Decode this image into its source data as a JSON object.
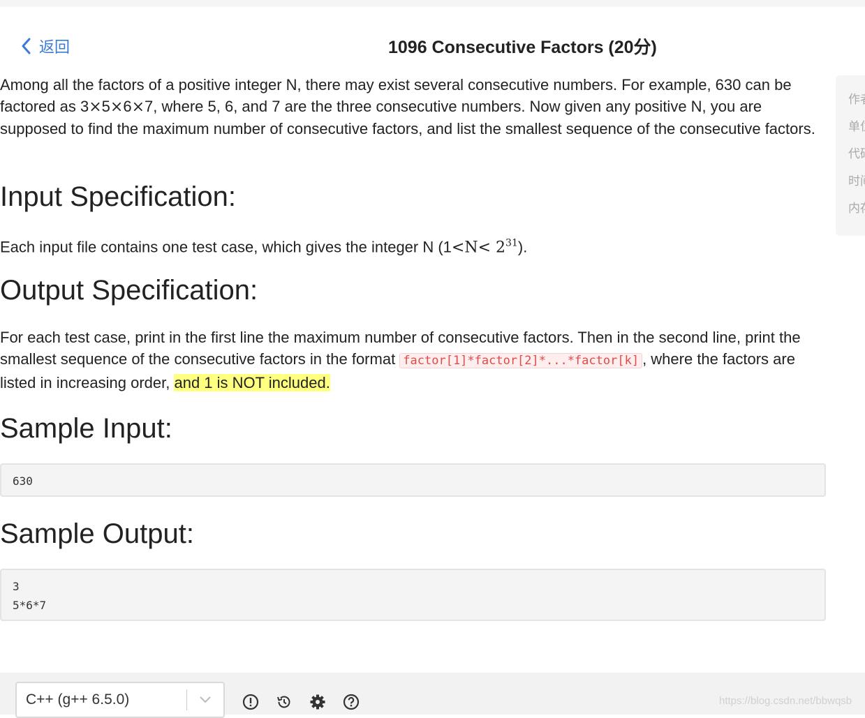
{
  "header": {
    "back_label": "返回",
    "title": "1096 Consecutive Factors (20分)"
  },
  "problem": {
    "intro_1": "Among all the factors of a positive integer N, there may exist several consecutive numbers. For example, 630 can be factored as 3",
    "intro_x1": "×",
    "intro_5": "5",
    "intro_x2": "×",
    "intro_6": "6",
    "intro_x3": "×",
    "intro_2": "7, where 5, 6, and 7 are the three consecutive numbers. Now given any positive N, you are supposed to find the maximum number of consecutive factors, and list the smallest sequence of the consecutive factors.",
    "input_heading": "Input Specification:",
    "input_text_1": "Each input file contains one test case, which gives the integer N (1",
    "input_lt1": "<",
    "input_N": "N",
    "input_lt2": "<",
    "input_pow_base": " 2",
    "input_pow_exp": "31",
    "input_text_2": ").",
    "output_heading": "Output Specification:",
    "output_text_1": "For each test case, print in the first line the maximum number of consecutive factors. Then in the second line, print the smallest sequence of the consecutive factors in the format ",
    "output_code": "factor[1]*factor[2]*...*factor[k]",
    "output_text_2": ", where the factors are listed in increasing order, ",
    "output_highlight": "and 1 is NOT included.",
    "sample_input_heading": "Sample Input:",
    "sample_input": "630",
    "sample_output_heading": "Sample Output:",
    "sample_output": "3\n5*6*7"
  },
  "sidebar": {
    "items": [
      "作者",
      "单位",
      "代码",
      "时间",
      "内存"
    ]
  },
  "editor": {
    "language": "C++ (g++ 6.5.0)",
    "tools": [
      "warning-icon",
      "history-icon",
      "gear-icon",
      "help-icon"
    ]
  },
  "watermark": "https://blog.csdn.net/bbwqsb",
  "colors": {
    "link": "#3a7bd5",
    "code_text": "#e04a4a",
    "highlight": "#ffff80"
  }
}
